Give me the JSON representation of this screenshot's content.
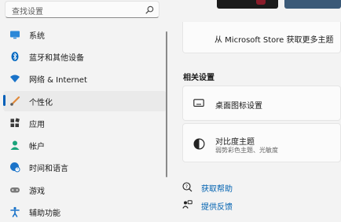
{
  "search": {
    "placeholder": "查找设置",
    "icon": "search-icon"
  },
  "nav": {
    "items": [
      {
        "label": "系统",
        "icon": "display-icon",
        "color": "#2b88d8"
      },
      {
        "label": "蓝牙和其他设备",
        "icon": "bluetooth-icon",
        "color": "#0067c0"
      },
      {
        "label": "网络 & Internet",
        "icon": "wifi-icon",
        "color": "#1a73c9"
      },
      {
        "label": "个性化",
        "icon": "brush-icon",
        "color": "#e08a3c"
      },
      {
        "label": "应用",
        "icon": "apps-icon",
        "color": "#3a3a3a"
      },
      {
        "label": "帐户",
        "icon": "person-icon",
        "color": "#1aa37a"
      },
      {
        "label": "时间和语言",
        "icon": "globe-clock-icon",
        "color": "#1a73c9"
      },
      {
        "label": "游戏",
        "icon": "gamepad-icon",
        "color": "#7a7a7a"
      },
      {
        "label": "辅助功能",
        "icon": "accessibility-icon",
        "color": "#1a73c9"
      }
    ],
    "active_index": 3,
    "accent": "#005fb8"
  },
  "store_card": {
    "text": "从 Microsoft Store 获取更多主题"
  },
  "related": {
    "title": "相关设置",
    "desktop_icons": {
      "label": "桌面图标设置",
      "icon": "monitor-icon"
    },
    "contrast": {
      "label": "对比度主题",
      "sub": "弱势彩色主题、光敏度",
      "icon": "contrast-icon"
    }
  },
  "links": {
    "help": {
      "label": "获取帮助",
      "icon": "help-icon"
    },
    "feedback": {
      "label": "提供反馈",
      "icon": "feedback-icon"
    }
  }
}
